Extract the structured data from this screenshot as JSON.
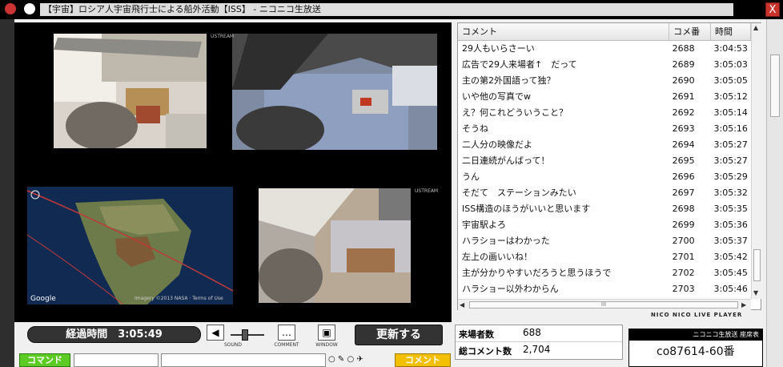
{
  "window": {
    "title": "【宇宙】ロシア人宇宙飛行士による船外活動【ISS】 - ニコニコ生放送",
    "close_label": "X"
  },
  "video": {
    "watermark_1": "USTREAM",
    "watermark_2": "USTREAM",
    "map_caption": "Imagery ©2013 NASA · Terms of Use",
    "map_logo": "Google"
  },
  "comments": {
    "headers": {
      "comment": "コメント",
      "number": "コメ番",
      "time": "時間"
    },
    "rows": [
      {
        "text": "29人もいらさーい",
        "num": "2688",
        "time": "3:04:53"
      },
      {
        "text": "広告で29人来場者↑　だって",
        "num": "2689",
        "time": "3:05:03"
      },
      {
        "text": "主の第2外国語って独？",
        "num": "2690",
        "time": "3:05:05"
      },
      {
        "text": "いや他の写真でw",
        "num": "2691",
        "time": "3:05:12"
      },
      {
        "text": "え？何これどういうこと？",
        "num": "2692",
        "time": "3:05:14"
      },
      {
        "text": "そうね",
        "num": "2693",
        "time": "3:05:16"
      },
      {
        "text": "二人分の映像だよ",
        "num": "2694",
        "time": "3:05:27"
      },
      {
        "text": "二日連続がんばって！",
        "num": "2695",
        "time": "3:05:27"
      },
      {
        "text": "うん",
        "num": "2696",
        "time": "3:05:29"
      },
      {
        "text": "そだて　ステーションみたい",
        "num": "2697",
        "time": "3:05:32"
      },
      {
        "text": "ISS構造のほうがいいと思います",
        "num": "2698",
        "time": "3:05:35"
      },
      {
        "text": "宇宙駅よろ",
        "num": "2699",
        "time": "3:05:36"
      },
      {
        "text": "ハラショーはわかった",
        "num": "2700",
        "time": "3:05:37"
      },
      {
        "text": "左上の画いいね！",
        "num": "2701",
        "time": "3:05:42"
      },
      {
        "text": "主が分かりやすいだろうと思うほうで",
        "num": "2702",
        "time": "3:05:45"
      },
      {
        "text": "ハラショー以外わからん",
        "num": "2703",
        "time": "3:05:46"
      }
    ],
    "hscroll_grip": "III"
  },
  "player": {
    "logo": "NICO NICO LIVE PLAYER",
    "elapsed": "経過時間　3:05:49",
    "sound_label": "SOUND",
    "comment_label": "COMMENT",
    "window_label": "WINDOW",
    "refresh_label": "更新する"
  },
  "bottom": {
    "command_label": "コマンド",
    "submit_label": "コメント"
  },
  "stats": {
    "visitors_label": "来場者数",
    "visitors_value": "688",
    "total_comments_label": "総コメント数",
    "total_comments_value": "2,704"
  },
  "seat": {
    "header": "ニコニコ生放送 座席表",
    "value": "co87614-60番"
  },
  "colors": {
    "command_green": "#5ccc24",
    "submit_yellow": "#f2c000",
    "close_red": "#c8332b"
  }
}
